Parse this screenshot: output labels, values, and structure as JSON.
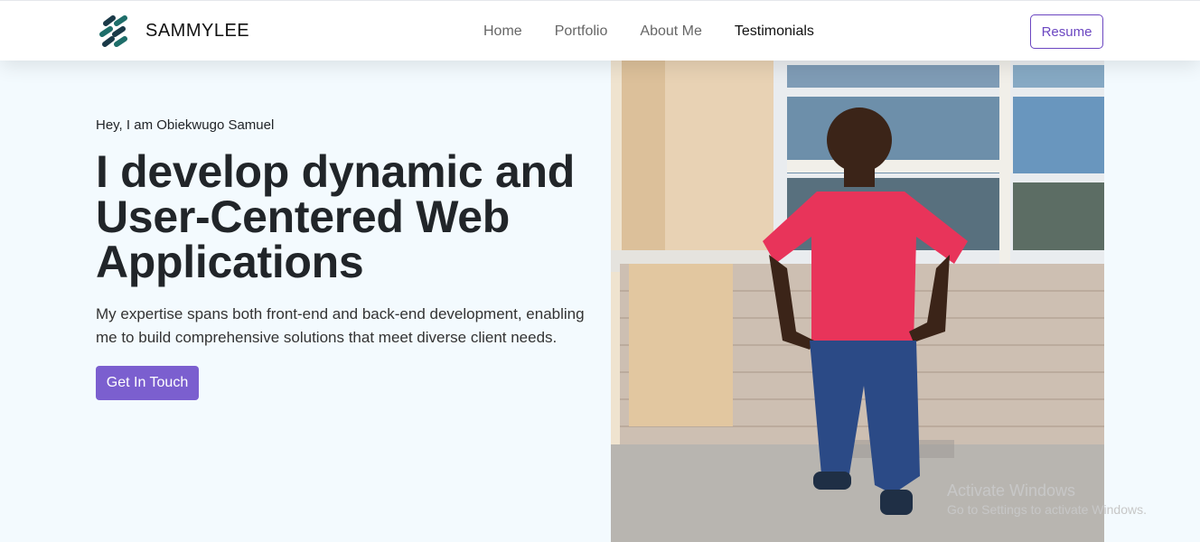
{
  "nav": {
    "brand": "SAMMYLEE",
    "links": [
      {
        "label": "Home"
      },
      {
        "label": "Portfolio"
      },
      {
        "label": "About Me"
      },
      {
        "label": "Testimonials"
      }
    ],
    "resume_label": "Resume"
  },
  "hero": {
    "greeting": "Hey, I am Obiekwugo Samuel",
    "headline": "I develop dynamic and User-Centered Web Applications",
    "description": "My expertise spans both front-end and back-end development, enabling me to build comprehensive solutions that meet diverse client needs.",
    "cta_label": "Get In Touch"
  },
  "watermark": {
    "line1": "Activate Windows",
    "line2": "Go to Settings to activate Windows."
  },
  "colors": {
    "accent": "#7b5fcf",
    "logo": "#1e6e6a",
    "background": "#f3fafe"
  }
}
